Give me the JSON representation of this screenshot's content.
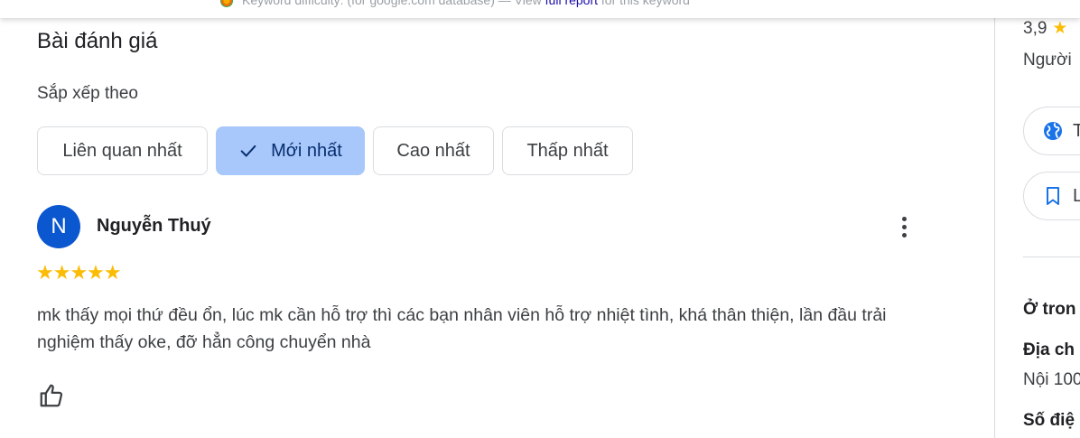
{
  "topbar": {
    "text_start": "Keyword difficulty:  (for google.com database) — View ",
    "link": "full report",
    "text_end": " for this keyword"
  },
  "reviews": {
    "title": "Bài đánh giá",
    "sort_label": "Sắp xếp theo",
    "sort_options": [
      {
        "label": "Liên quan nhất",
        "selected": false
      },
      {
        "label": "Mới nhất",
        "selected": true
      },
      {
        "label": "Cao nhất",
        "selected": false
      },
      {
        "label": "Thấp nhất",
        "selected": false
      }
    ],
    "items": [
      {
        "avatar_initial": "N",
        "name": "Nguyễn Thuý",
        "stars": "★★★★★",
        "rating": 5,
        "text": "mk thấy mọi thứ đều ổn, lúc mk cần hỗ trợ thì các bạn nhân viên hỗ trợ nhiệt tình, khá thân thiện, lần đầu trải nghiệm thấy oke, đỡ hẳn công chuyển nhà"
      }
    ]
  },
  "sidebar": {
    "rating": "3,9",
    "rating_star": "★",
    "people": "Người",
    "website_label": "T",
    "save_label": "L",
    "in_label": "Ở tron",
    "address_label": "Địa ch",
    "address_value": "Nội 100",
    "phone_label": "Số điệ"
  },
  "colors": {
    "accent_selected": "#a8c7fa",
    "avatar_bg": "#0b57d0",
    "star": "#fbbc04",
    "icon_blue": "#1a73e8"
  }
}
